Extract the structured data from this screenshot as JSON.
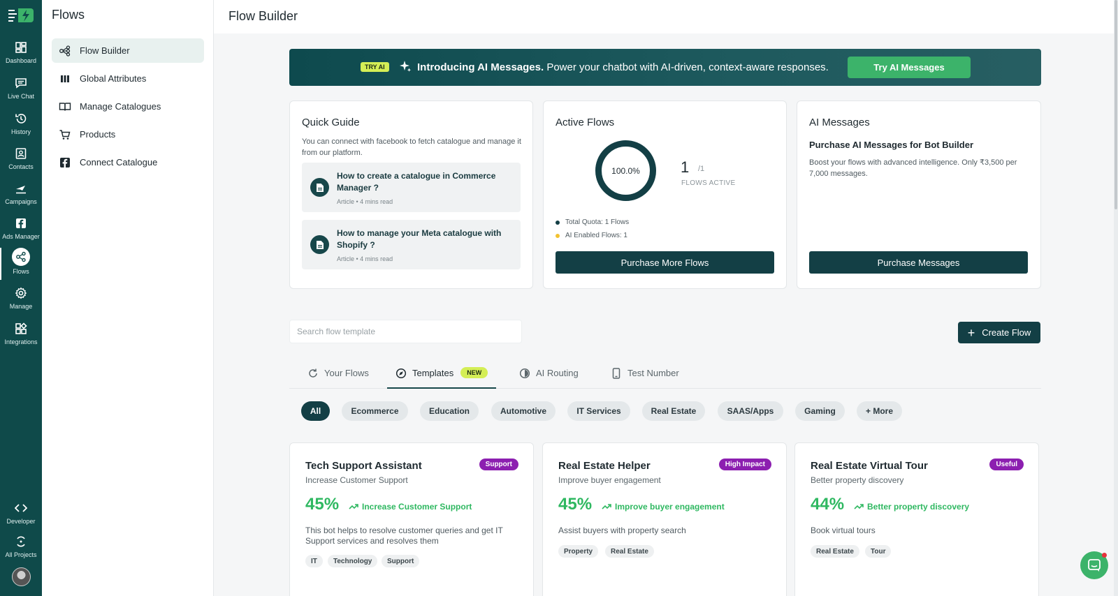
{
  "rail": {
    "items": [
      {
        "label": "Dashboard",
        "icon": "dashboard-icon"
      },
      {
        "label": "Live Chat",
        "icon": "chat-icon"
      },
      {
        "label": "History",
        "icon": "history-icon"
      },
      {
        "label": "Contacts",
        "icon": "contacts-icon"
      },
      {
        "label": "Campaigns",
        "icon": "campaigns-icon"
      },
      {
        "label": "Ads Manager",
        "icon": "facebook-icon"
      },
      {
        "label": "Flows",
        "icon": "flows-icon"
      },
      {
        "label": "Manage",
        "icon": "gear-icon"
      },
      {
        "label": "Integrations",
        "icon": "integrations-icon"
      }
    ],
    "bottom": [
      {
        "label": "Developer",
        "icon": "code-icon"
      },
      {
        "label": "All Projects",
        "icon": "projects-icon"
      }
    ],
    "active": "Flows"
  },
  "subnav": {
    "title": "Flows",
    "items": [
      {
        "label": "Flow Builder",
        "icon": "flow-builder-icon"
      },
      {
        "label": "Global Attributes",
        "icon": "columns-icon"
      },
      {
        "label": "Manage Catalogues",
        "icon": "book-icon"
      },
      {
        "label": "Products",
        "icon": "cart-icon"
      },
      {
        "label": "Connect Catalogue",
        "icon": "facebook-icon"
      }
    ]
  },
  "header": {
    "title": "Flow Builder"
  },
  "banner": {
    "badge": "TRY AI",
    "headline": "Introducing AI Messages.",
    "text": " Power your chatbot with AI-driven, context-aware responses.",
    "button": "Try AI Messages"
  },
  "quick_guide": {
    "title": "Quick Guide",
    "description": "You can connect with facebook to fetch catalogue and manage it from our platform.",
    "articles": [
      {
        "title": "How to create a catalogue in Commerce Manager ?",
        "meta": "Article • 4 mins read"
      },
      {
        "title": "How to manage your Meta catalogue with Shopify ?",
        "meta": "Article • 4 mins read"
      }
    ]
  },
  "active_flows": {
    "title": "Active Flows",
    "percent_label": "100.0%",
    "percent": 100,
    "count": "1",
    "total": "/1",
    "caption": "FLOWS ACTIVE",
    "legend": [
      {
        "label": "Total Quota: 1 Flows",
        "color": "#133f45"
      },
      {
        "label": "AI Enabled Flows: 1",
        "color": "#f2c230"
      }
    ],
    "button": "Purchase More Flows"
  },
  "ai_messages": {
    "title": "AI Messages",
    "subtitle": "Purchase AI Messages for Bot Builder",
    "description": "Boost your flows with advanced intelligence. Only ₹3,500 per 7,000 messages.",
    "button": "Purchase Messages"
  },
  "search": {
    "placeholder": "Search flow template",
    "value": ""
  },
  "create_button": "Create Flow",
  "tabs": [
    {
      "label": "Your Flows",
      "icon": "refresh-icon"
    },
    {
      "label": "Templates",
      "icon": "compass-icon",
      "badge": "NEW"
    },
    {
      "label": "AI Routing",
      "icon": "routing-icon"
    },
    {
      "label": "Test Number",
      "icon": "phone-icon"
    }
  ],
  "active_tab": "Templates",
  "filters": [
    "All",
    "Ecommerce",
    "Education",
    "Automotive",
    "IT Services",
    "Real Estate",
    "SAAS/Apps",
    "Gaming",
    "+ More"
  ],
  "active_filter": "All",
  "templates": [
    {
      "title": "Tech Support Assistant",
      "subtitle": "Increase Customer Support",
      "badge": "Support",
      "percent": "45%",
      "trend": "Increase Customer Support",
      "description": "This bot helps to resolve customer queries and get IT Support services and resolves them",
      "tags": [
        "IT",
        "Technology",
        "Support"
      ]
    },
    {
      "title": "Real Estate Helper",
      "subtitle": "Improve buyer engagement",
      "badge": "High Impact",
      "percent": "45%",
      "trend": "Improve buyer engagement",
      "description": "Assist buyers with property search",
      "tags": [
        "Property",
        "Real Estate"
      ]
    },
    {
      "title": "Real Estate Virtual Tour",
      "subtitle": "Better property discovery",
      "badge": "Useful",
      "percent": "44%",
      "trend": "Better property discovery",
      "description": "Book virtual tours",
      "tags": [
        "Real Estate",
        "Tour"
      ]
    }
  ],
  "colors": {
    "rail": "#0f4a4a",
    "primary": "#133f45",
    "accent_green": "#3cb36a",
    "badge_lime": "#d4ee56",
    "badge_purple": "#8c1fb0"
  }
}
